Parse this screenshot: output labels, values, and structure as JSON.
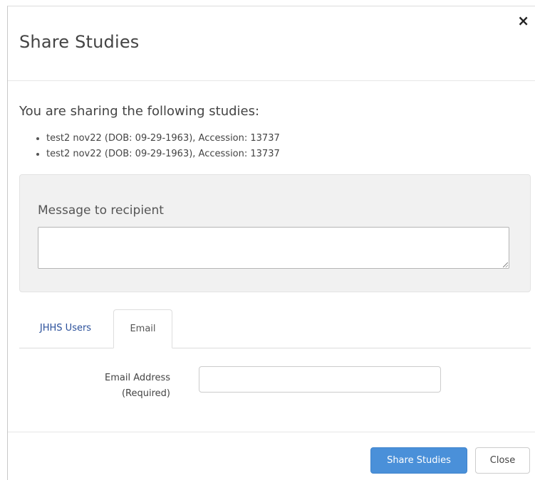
{
  "dialog": {
    "title": "Share Studies",
    "close_glyph": "×"
  },
  "studies": {
    "intro": "You are sharing the following studies:",
    "items": [
      "test2 nov22 (DOB: 09-29-1963), Accession: 13737",
      "test2 nov22 (DOB: 09-29-1963), Accession: 13737"
    ]
  },
  "message": {
    "label": "Message to recipient",
    "value": ""
  },
  "tabs": {
    "jhhs_users": "JHHS Users",
    "email": "Email",
    "active": "Email"
  },
  "email_form": {
    "label_line1": "Email Address",
    "label_line2": "(Required)",
    "value": ""
  },
  "footer": {
    "share_label": "Share Studies",
    "close_label": "Close"
  },
  "colors": {
    "primary": "#4a90d9",
    "link": "#2a4f9a",
    "panel_bg": "#f1f1f1"
  },
  "icons": {
    "close": "close-icon",
    "resize": "resize-grip-icon"
  }
}
